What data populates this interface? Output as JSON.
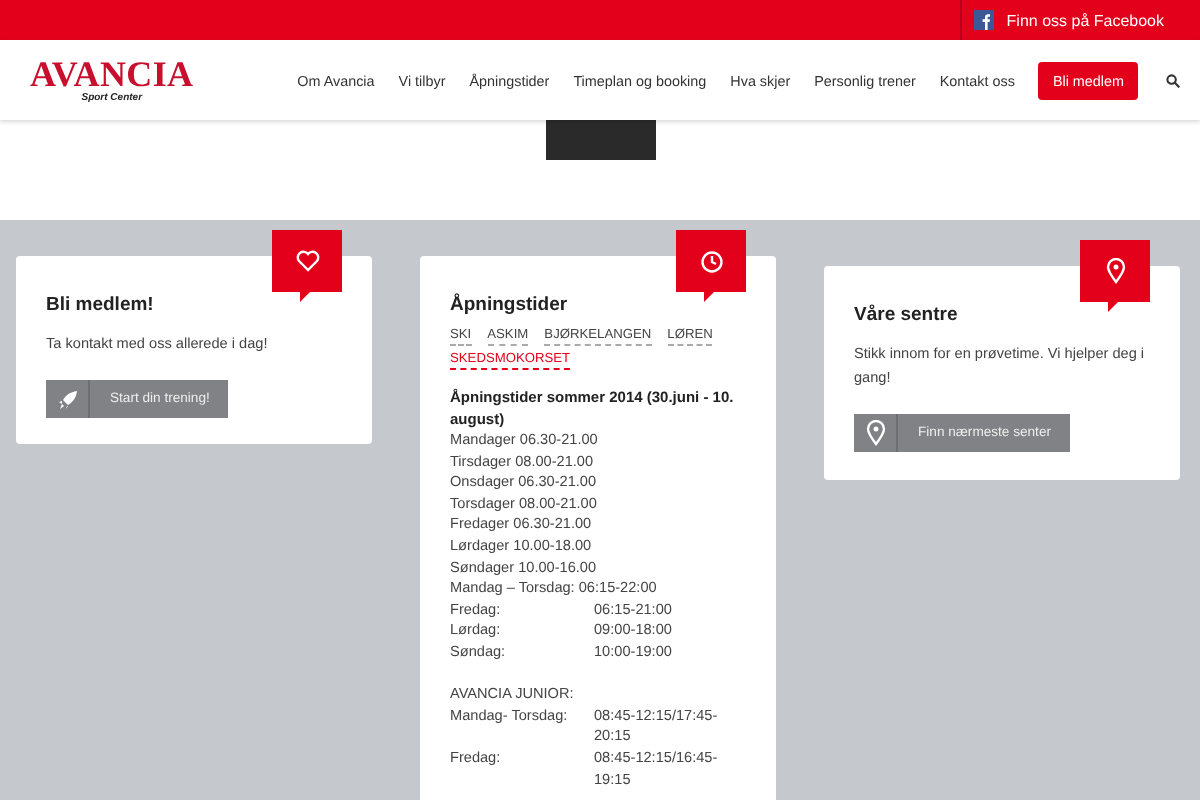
{
  "topbar": {
    "facebook_link": "Finn oss på Facebook"
  },
  "header": {
    "logo": "AVANCIA",
    "logo_sub": "Sport Center",
    "nav": [
      {
        "label": "Om Avancia",
        "kind": "link"
      },
      {
        "label": "Vi tilbyr",
        "kind": "link"
      },
      {
        "label": "Åpningstider",
        "kind": "link"
      },
      {
        "label": "Timeplan og booking",
        "kind": "link"
      },
      {
        "label": "Hva skjer",
        "kind": "link"
      },
      {
        "label": "Personlig trener",
        "kind": "link"
      },
      {
        "label": "Kontakt oss",
        "kind": "link"
      },
      {
        "label": "Bli medlem",
        "kind": "button"
      }
    ]
  },
  "cards": [
    {
      "kind": "cta",
      "title": "Bli medlem!",
      "text": "Ta kontakt med oss allerede i dag!",
      "button": {
        "label": "Start din trening!"
      }
    },
    {
      "kind": "hours",
      "title": "Åpningstider",
      "tabs": [
        {
          "label": "SKI",
          "selected": false
        },
        {
          "label": "ASKIM",
          "selected": false
        },
        {
          "label": "BJØRKELANGEN",
          "selected": false
        },
        {
          "label": "LØREN",
          "selected": false
        },
        {
          "label": "SKEDSMOKORSET",
          "selected": true
        }
      ],
      "heading": "Åpningstider sommer 2014 (30.juni - 10. august)",
      "lines": [
        {
          "label": "Mandager 06.30-21.00"
        },
        {
          "label": "Tirsdager 08.00-21.00"
        },
        {
          "label": "Onsdager 06.30-21.00"
        },
        {
          "label": "Torsdager 08.00-21.00"
        },
        {
          "label": "Fredager 06.30-21.00"
        },
        {
          "label": "Lørdager 10.00-18.00"
        },
        {
          "label": "Søndager 10.00-16.00"
        },
        {
          "label": "Mandag – Torsdag: 06:15-22:00"
        },
        {
          "label": "Fredag:",
          "value": "06:15-21:00"
        },
        {
          "label": "Lørdag:",
          "value": "09:00-18:00"
        },
        {
          "label": "Søndag:",
          "value": "10:00-19:00"
        },
        {
          "kind": "blank"
        },
        {
          "label": "AVANCIA JUNIOR:"
        },
        {
          "label": "Mandag- Torsdag:",
          "value": "08:45-12:15/17:45-20:15"
        },
        {
          "label": "Fredag:",
          "value": "08:45-12:15/16:45-19:15"
        }
      ]
    },
    {
      "kind": "cta",
      "title": "Våre sentre",
      "text": "Stikk innom for en prøvetime. Vi hjelper deg i gang!",
      "button": {
        "label": "Finn nærmeste senter"
      }
    }
  ]
}
